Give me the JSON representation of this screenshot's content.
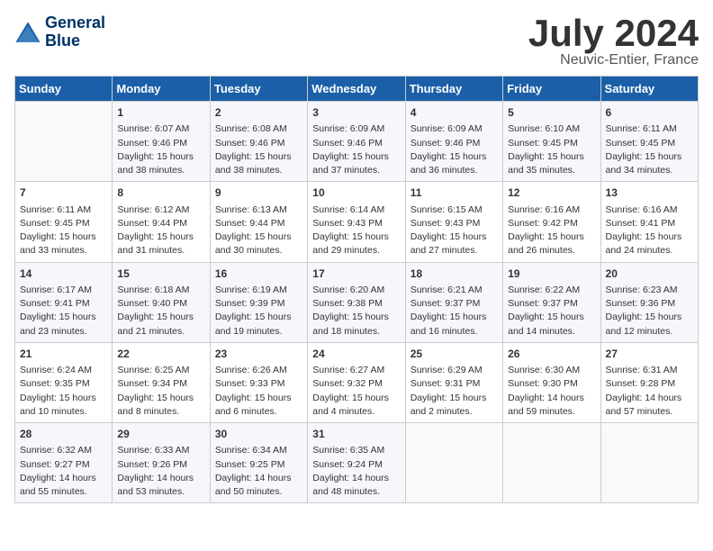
{
  "header": {
    "logo_line1": "General",
    "logo_line2": "Blue",
    "month": "July 2024",
    "location": "Neuvic-Entier, France"
  },
  "days_of_week": [
    "Sunday",
    "Monday",
    "Tuesday",
    "Wednesday",
    "Thursday",
    "Friday",
    "Saturday"
  ],
  "weeks": [
    [
      {
        "day": "",
        "content": ""
      },
      {
        "day": "1",
        "content": "Sunrise: 6:07 AM\nSunset: 9:46 PM\nDaylight: 15 hours\nand 38 minutes."
      },
      {
        "day": "2",
        "content": "Sunrise: 6:08 AM\nSunset: 9:46 PM\nDaylight: 15 hours\nand 38 minutes."
      },
      {
        "day": "3",
        "content": "Sunrise: 6:09 AM\nSunset: 9:46 PM\nDaylight: 15 hours\nand 37 minutes."
      },
      {
        "day": "4",
        "content": "Sunrise: 6:09 AM\nSunset: 9:46 PM\nDaylight: 15 hours\nand 36 minutes."
      },
      {
        "day": "5",
        "content": "Sunrise: 6:10 AM\nSunset: 9:45 PM\nDaylight: 15 hours\nand 35 minutes."
      },
      {
        "day": "6",
        "content": "Sunrise: 6:11 AM\nSunset: 9:45 PM\nDaylight: 15 hours\nand 34 minutes."
      }
    ],
    [
      {
        "day": "7",
        "content": "Sunrise: 6:11 AM\nSunset: 9:45 PM\nDaylight: 15 hours\nand 33 minutes."
      },
      {
        "day": "8",
        "content": "Sunrise: 6:12 AM\nSunset: 9:44 PM\nDaylight: 15 hours\nand 31 minutes."
      },
      {
        "day": "9",
        "content": "Sunrise: 6:13 AM\nSunset: 9:44 PM\nDaylight: 15 hours\nand 30 minutes."
      },
      {
        "day": "10",
        "content": "Sunrise: 6:14 AM\nSunset: 9:43 PM\nDaylight: 15 hours\nand 29 minutes."
      },
      {
        "day": "11",
        "content": "Sunrise: 6:15 AM\nSunset: 9:43 PM\nDaylight: 15 hours\nand 27 minutes."
      },
      {
        "day": "12",
        "content": "Sunrise: 6:16 AM\nSunset: 9:42 PM\nDaylight: 15 hours\nand 26 minutes."
      },
      {
        "day": "13",
        "content": "Sunrise: 6:16 AM\nSunset: 9:41 PM\nDaylight: 15 hours\nand 24 minutes."
      }
    ],
    [
      {
        "day": "14",
        "content": "Sunrise: 6:17 AM\nSunset: 9:41 PM\nDaylight: 15 hours\nand 23 minutes."
      },
      {
        "day": "15",
        "content": "Sunrise: 6:18 AM\nSunset: 9:40 PM\nDaylight: 15 hours\nand 21 minutes."
      },
      {
        "day": "16",
        "content": "Sunrise: 6:19 AM\nSunset: 9:39 PM\nDaylight: 15 hours\nand 19 minutes."
      },
      {
        "day": "17",
        "content": "Sunrise: 6:20 AM\nSunset: 9:38 PM\nDaylight: 15 hours\nand 18 minutes."
      },
      {
        "day": "18",
        "content": "Sunrise: 6:21 AM\nSunset: 9:37 PM\nDaylight: 15 hours\nand 16 minutes."
      },
      {
        "day": "19",
        "content": "Sunrise: 6:22 AM\nSunset: 9:37 PM\nDaylight: 15 hours\nand 14 minutes."
      },
      {
        "day": "20",
        "content": "Sunrise: 6:23 AM\nSunset: 9:36 PM\nDaylight: 15 hours\nand 12 minutes."
      }
    ],
    [
      {
        "day": "21",
        "content": "Sunrise: 6:24 AM\nSunset: 9:35 PM\nDaylight: 15 hours\nand 10 minutes."
      },
      {
        "day": "22",
        "content": "Sunrise: 6:25 AM\nSunset: 9:34 PM\nDaylight: 15 hours\nand 8 minutes."
      },
      {
        "day": "23",
        "content": "Sunrise: 6:26 AM\nSunset: 9:33 PM\nDaylight: 15 hours\nand 6 minutes."
      },
      {
        "day": "24",
        "content": "Sunrise: 6:27 AM\nSunset: 9:32 PM\nDaylight: 15 hours\nand 4 minutes."
      },
      {
        "day": "25",
        "content": "Sunrise: 6:29 AM\nSunset: 9:31 PM\nDaylight: 15 hours\nand 2 minutes."
      },
      {
        "day": "26",
        "content": "Sunrise: 6:30 AM\nSunset: 9:30 PM\nDaylight: 14 hours\nand 59 minutes."
      },
      {
        "day": "27",
        "content": "Sunrise: 6:31 AM\nSunset: 9:28 PM\nDaylight: 14 hours\nand 57 minutes."
      }
    ],
    [
      {
        "day": "28",
        "content": "Sunrise: 6:32 AM\nSunset: 9:27 PM\nDaylight: 14 hours\nand 55 minutes."
      },
      {
        "day": "29",
        "content": "Sunrise: 6:33 AM\nSunset: 9:26 PM\nDaylight: 14 hours\nand 53 minutes."
      },
      {
        "day": "30",
        "content": "Sunrise: 6:34 AM\nSunset: 9:25 PM\nDaylight: 14 hours\nand 50 minutes."
      },
      {
        "day": "31",
        "content": "Sunrise: 6:35 AM\nSunset: 9:24 PM\nDaylight: 14 hours\nand 48 minutes."
      },
      {
        "day": "",
        "content": ""
      },
      {
        "day": "",
        "content": ""
      },
      {
        "day": "",
        "content": ""
      }
    ]
  ]
}
